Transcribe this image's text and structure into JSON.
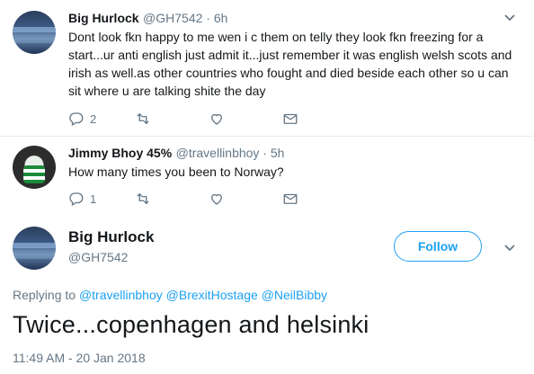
{
  "tweet1": {
    "name": "Big Hurlock",
    "handle": "@GH7542 · 6h",
    "lines": [
      "Dont look fkn happy to me wen i c them on telly they look fkn freezing for a",
      "start...ur anti english just admit it...just remember it was english welsh scots and",
      "irish as well.as other countries who fought and died beside each other so u can",
      "sit where u are talking shite the day"
    ],
    "reply_count": "2"
  },
  "tweet2": {
    "name": "Jimmy Bhoy 45%",
    "handle": "@travellinbhoy · 5h",
    "text": "How many times you been to Norway?",
    "reply_count": "1"
  },
  "main": {
    "name": "Big Hurlock",
    "handle": "@GH7542",
    "follow_label": "Follow",
    "replying_label": "Replying to",
    "mentions": [
      "@travellinbhoy",
      "@BrexitHostage",
      "@NeilBibby"
    ],
    "text": "Twice...copenhagen and helsinki",
    "timestamp": "11:49 AM - 20 Jan 2018"
  },
  "colors": {
    "accent": "#1da1f2",
    "muted": "#657786",
    "divider": "#e6ecf0"
  },
  "icons": [
    "reply-icon",
    "retweet-icon",
    "like-icon",
    "dm-icon",
    "chevron-down-icon"
  ]
}
